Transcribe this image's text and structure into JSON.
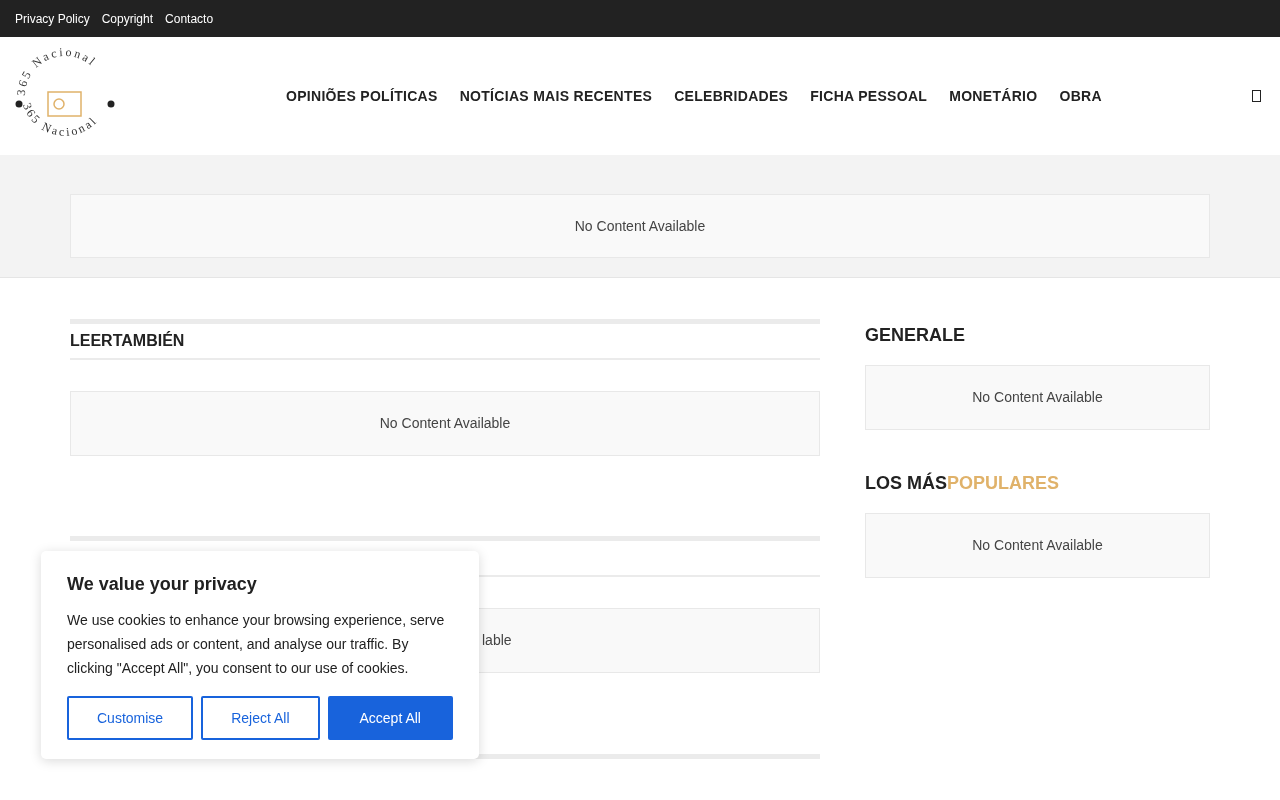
{
  "top_links": [
    "Privacy Policy",
    "Copyright",
    "Contacto"
  ],
  "logo": {
    "ring_text": [
      "365 Nacional",
      "365 Nacional"
    ]
  },
  "nav": [
    "OPINIÕES POLÍTICAS",
    "NOTÍCIAS MAIS RECENTES",
    "CELEBRIDADES",
    "FICHA PESSOAL",
    "MONETÁRIO",
    "OBRA"
  ],
  "banner": {
    "message": "No Content Available"
  },
  "main_sections": [
    {
      "heading": "LEERTAMBIÉN",
      "message": "No Content Available"
    },
    {
      "message": "lable"
    }
  ],
  "sidebar": [
    {
      "heading": "GENERALE",
      "message": "No Content Available"
    },
    {
      "heading": "LOS MÁS",
      "heading_accent": "POPULARES",
      "message": "No Content Available"
    }
  ],
  "cookie": {
    "title": "We value your privacy",
    "text": "We use cookies to enhance your browsing experience, serve personalised ads or content, and analyse our traffic. By clicking \"Accept All\", you consent to our use of cookies.",
    "buttons": [
      {
        "label": "Customise",
        "kind": "outline"
      },
      {
        "label": "Reject All",
        "kind": "outline"
      },
      {
        "label": "Accept All",
        "kind": "primary"
      }
    ]
  }
}
